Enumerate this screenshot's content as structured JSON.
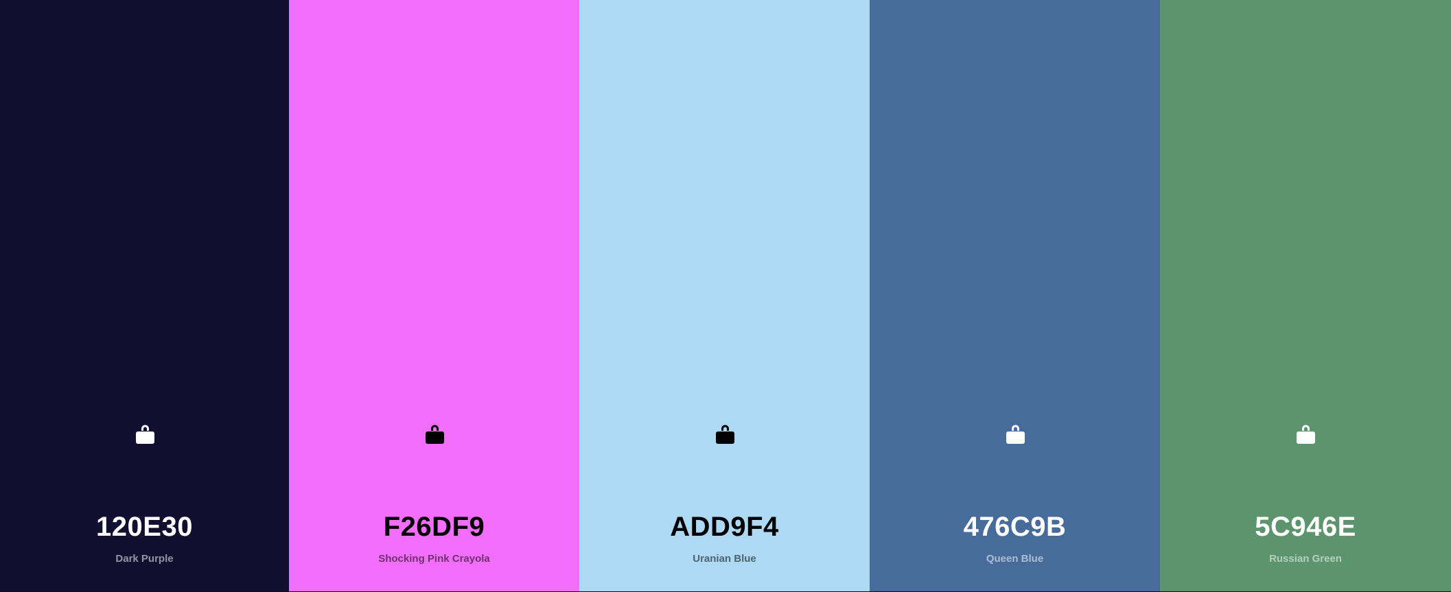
{
  "palette": {
    "swatches": [
      {
        "hex": "120E30",
        "name": "Dark Purple",
        "color": "#120E30",
        "text_tone": "light",
        "icon": "lock-icon"
      },
      {
        "hex": "F26DF9",
        "name": "Shocking Pink Crayola",
        "color": "#F26DF9",
        "text_tone": "dark",
        "icon": "lock-icon"
      },
      {
        "hex": "ADD9F4",
        "name": "Uranian Blue",
        "color": "#ADD9F4",
        "text_tone": "dark",
        "icon": "lock-icon"
      },
      {
        "hex": "476C9B",
        "name": "Queen Blue",
        "color": "#476C9B",
        "text_tone": "light",
        "icon": "lock-icon"
      },
      {
        "hex": "5C946E",
        "name": "Russian Green",
        "color": "#5C946E",
        "text_tone": "light",
        "icon": "lock-icon"
      }
    ]
  }
}
